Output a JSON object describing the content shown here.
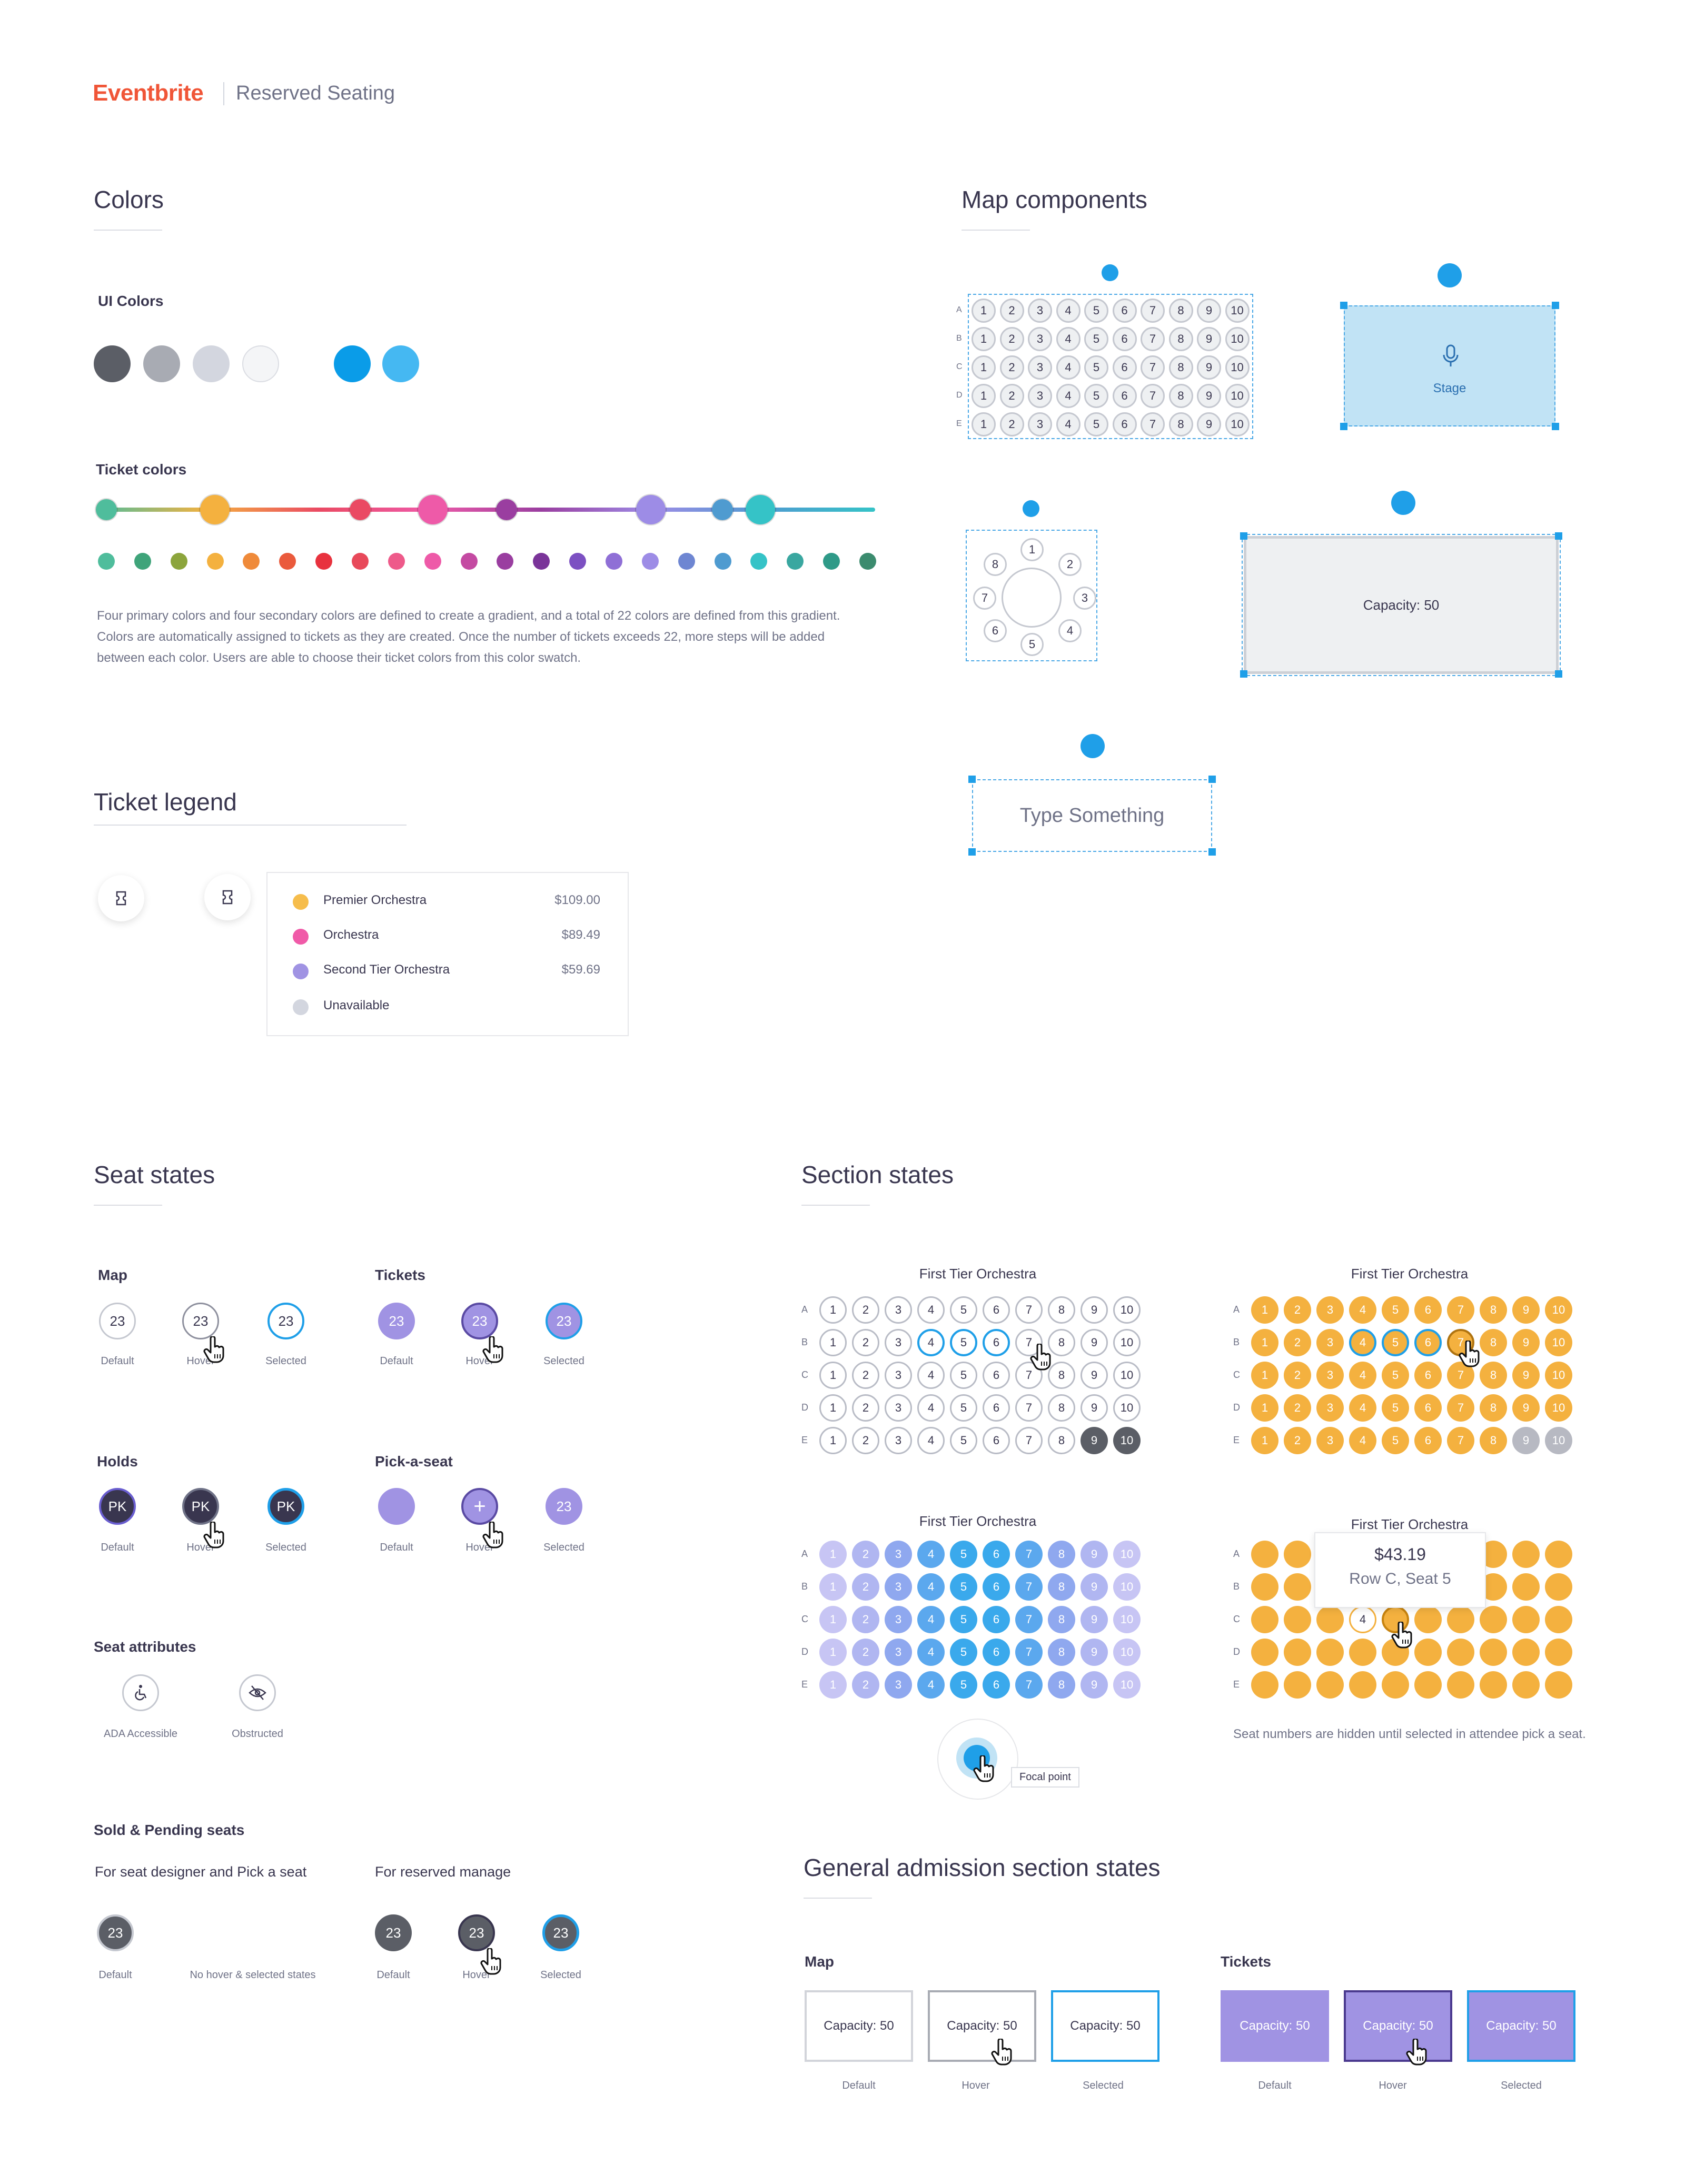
{
  "header": {
    "brand": "Eventbrite",
    "product": "Reserved Seating"
  },
  "colors": {
    "title": "Colors",
    "ui_label": "UI Colors",
    "ui_swatches": [
      "#5b5e66",
      "#a8abb3",
      "#d3d6df",
      "#f4f5f7",
      "#0a9ce8",
      "#45b8f2"
    ],
    "ticket_label": "Ticket colors",
    "gradient_primary": [
      {
        "color": "#4fbd9c",
        "size": "small"
      },
      {
        "color": "#f4b13f",
        "size": "large"
      },
      {
        "color": "#ea4a63",
        "size": "small"
      },
      {
        "color": "#ee5aa8",
        "size": "large"
      },
      {
        "color": "#9a3ea0",
        "size": "small"
      },
      {
        "color": "#9d8ce6",
        "size": "large"
      },
      {
        "color": "#4f9bd0",
        "size": "small"
      },
      {
        "color": "#35c3c7",
        "size": "large"
      }
    ],
    "gradient_colors": [
      "#4fbd9c",
      "#3fa47a",
      "#8ca53c",
      "#f4b13f",
      "#ef8a3a",
      "#ea5a3c",
      "#e8323e",
      "#e8495a",
      "#ee5a8a",
      "#ee5aa8",
      "#c44aa2",
      "#9a3ea0",
      "#7a3499",
      "#7c50c2",
      "#8f6fd6",
      "#9d8ce6",
      "#6e86d2",
      "#4f9bd0",
      "#35c3c7",
      "#3aa7a0",
      "#2f9a88",
      "#3b8b6e"
    ],
    "description": "Four primary colors and four secondary colors are defined to create a gradient, and a total of 22 colors are defined from this gradient. Colors are automatically assigned to tickets as they are created. Once the number of tickets exceeds 22, more steps will be added between each color. Users are able to choose their ticket colors from this color swatch."
  },
  "map_components": {
    "title": "Map components",
    "grid_rows": [
      "A",
      "B",
      "C",
      "D",
      "E"
    ],
    "grid_seats": [
      "1",
      "2",
      "3",
      "4",
      "5",
      "6",
      "7",
      "8",
      "9",
      "10"
    ],
    "stage_label": "Stage",
    "table_seats": [
      "1",
      "2",
      "3",
      "4",
      "5",
      "6",
      "7",
      "8"
    ],
    "ga_label": "Capacity: 50",
    "text_placeholder": "Type Something",
    "icons": [
      "rotate-icon",
      "microphone-icon"
    ]
  },
  "ticket_legend": {
    "title": "Ticket legend",
    "items": [
      {
        "name": "Premier Orchestra",
        "price": "$109.00",
        "color": "#f6bd4c"
      },
      {
        "name": "Orchestra",
        "price": "$89.49",
        "color": "#f05aa8"
      },
      {
        "name": "Second Tier Orchestra",
        "price": "$59.69",
        "color": "#a093e3"
      },
      {
        "name": "Unavailable",
        "price": "",
        "color": "#d3d6df"
      }
    ]
  },
  "seat_states": {
    "title": "Seat states",
    "map_label": "Map",
    "tickets_label": "Tickets",
    "holds_label": "Holds",
    "pick_label": "Pick-a-seat",
    "attributes_label": "Seat attributes",
    "sold_label": "Sold & Pending seats",
    "sold_sub1": "For seat designer and Pick a seat",
    "sold_sub2": "For reserved manage",
    "seat_number": "23",
    "hold_initials": "PK",
    "state_default": "Default",
    "state_hover": "Hover",
    "state_selected": "Selected",
    "no_hover": "No hover & selected states",
    "ada": "ADA Accessible",
    "obstructed": "Obstructed"
  },
  "section_states": {
    "title": "Section states",
    "section_name": "First Tier Orchestra",
    "rows": [
      "A",
      "B",
      "C",
      "D",
      "E"
    ],
    "seats": [
      "1",
      "2",
      "3",
      "4",
      "5",
      "6",
      "7",
      "8",
      "9",
      "10"
    ],
    "focal_label": "Focal point",
    "tooltip_price": "$43.19",
    "tooltip_seat": "Row C, Seat 5",
    "hidden_note": "Seat numbers are hidden until selected in attendee pick a seat.",
    "tooltip_seat_num": "4"
  },
  "ga_states": {
    "title": "General admission section states",
    "map_label": "Map",
    "tickets_label": "Tickets",
    "capacity": "Capacity: 50",
    "state_default": "Default",
    "state_hover": "Hover",
    "state_selected": "Selected"
  }
}
